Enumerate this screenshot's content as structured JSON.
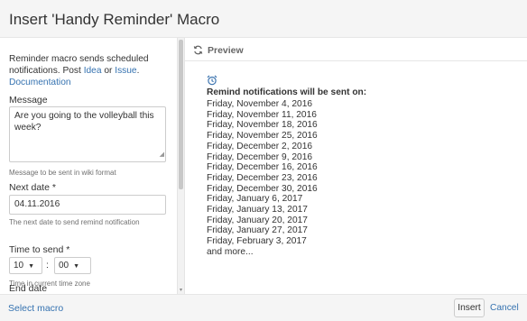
{
  "dialog": {
    "title": "Insert 'Handy Reminder' Macro"
  },
  "form": {
    "intro_text": "Reminder macro sends scheduled notifications. Post ",
    "idea_link": "Idea",
    "or_text": " or ",
    "issue_link": "Issue",
    "period": ".",
    "documentation_link": "Documentation",
    "message_label": "Message",
    "message_value": "Are you going to the volleyball this week?",
    "message_hint": "Message to be sent in wiki format",
    "next_date_label": "Next date *",
    "next_date_value": "04.11.2016",
    "next_date_hint": "The next date to send remind notification",
    "time_label": "Time to send *",
    "time_hour": "10",
    "time_separator": ":",
    "time_minute": "00",
    "time_hint": "Time in current time zone",
    "end_date_label": "End date"
  },
  "preview": {
    "title": "Preview",
    "heading": "Remind notifications will be sent on:",
    "dates": [
      "Friday, November 4, 2016",
      "Friday, November 11, 2016",
      "Friday, November 18, 2016",
      "Friday, November 25, 2016",
      "Friday, December 2, 2016",
      "Friday, December 9, 2016",
      "Friday, December 16, 2016",
      "Friday, December 23, 2016",
      "Friday, December 30, 2016",
      "Friday, January 6, 2017",
      "Friday, January 13, 2017",
      "Friday, January 20, 2017",
      "Friday, January 27, 2017",
      "Friday, February 3, 2017",
      "and more..."
    ]
  },
  "footer": {
    "select_macro": "Select macro",
    "insert": "Insert",
    "cancel": "Cancel"
  },
  "icons": {
    "refresh": "refresh-icon",
    "alarm": "alarm-clock-icon",
    "caret": "caret-down-icon"
  },
  "colors": {
    "link": "#3572b0",
    "alarm_icon": "#3b73af",
    "header_bg": "#f5f5f5"
  }
}
